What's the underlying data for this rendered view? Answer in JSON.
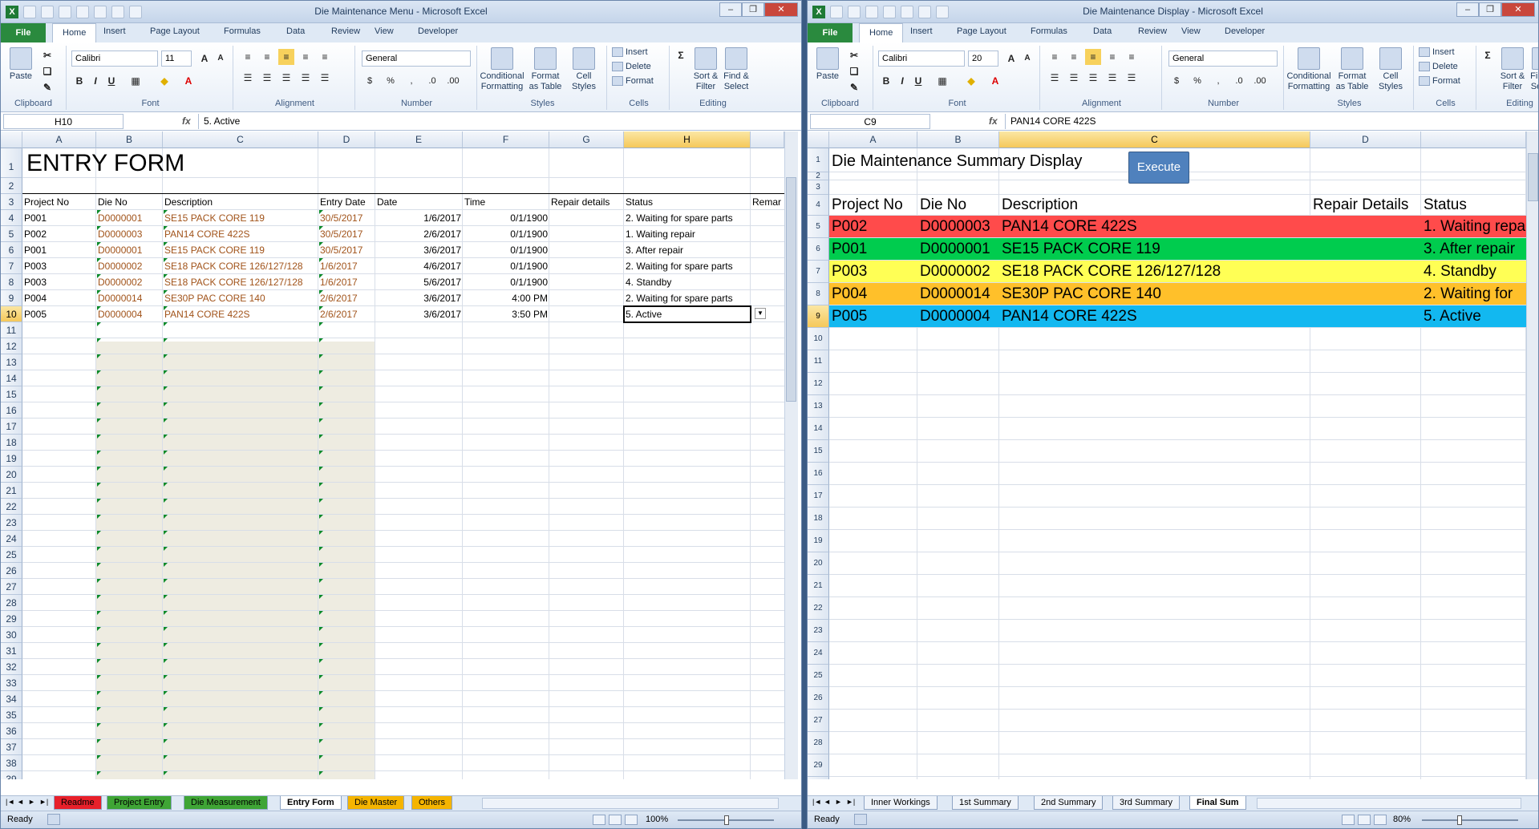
{
  "left": {
    "title": "Die Maintenance Menu - Microsoft Excel",
    "tabs": [
      "File",
      "Home",
      "Insert",
      "Page Layout",
      "Formulas",
      "Data",
      "Review",
      "View",
      "Developer"
    ],
    "ribbon": {
      "clipboard": "Clipboard",
      "paste": "Paste",
      "font_group": "Font",
      "font_name": "Calibri",
      "font_size": "11",
      "alignment": "Alignment",
      "number_group": "Number",
      "number_format": "General",
      "conditional": "Conditional Formatting",
      "format_table": "Format as Table",
      "cell_styles": "Cell Styles",
      "styles": "Styles",
      "insert": "Insert",
      "delete": "Delete",
      "format": "Format",
      "cells": "Cells",
      "sort": "Sort & Filter",
      "find": "Find & Select",
      "editing": "Editing"
    },
    "namebox": "H10",
    "formula": "5. Active",
    "columns": [
      "A",
      "B",
      "C",
      "D",
      "E",
      "F",
      "G",
      "H"
    ],
    "title_cell": "ENTRY FORM",
    "headers": [
      "Project No",
      "Die No",
      "Description",
      "Entry Date",
      "Date",
      "Time",
      "Repair details",
      "Status",
      "Remar"
    ],
    "rows": [
      [
        "P001",
        "D0000001",
        "SE15 PACK CORE 119",
        "30/5/2017",
        "1/6/2017",
        "0/1/1900",
        "",
        "2. Waiting for spare parts"
      ],
      [
        "P002",
        "D0000003",
        "PAN14 CORE 422S",
        "30/5/2017",
        "2/6/2017",
        "0/1/1900",
        "",
        "1. Waiting repair"
      ],
      [
        "P001",
        "D0000001",
        "SE15 PACK CORE 119",
        "30/5/2017",
        "3/6/2017",
        "0/1/1900",
        "",
        "3. After repair"
      ],
      [
        "P003",
        "D0000002",
        "SE18 PACK CORE 126/127/128",
        "1/6/2017",
        "4/6/2017",
        "0/1/1900",
        "",
        "2. Waiting for spare parts"
      ],
      [
        "P003",
        "D0000002",
        "SE18 PACK CORE 126/127/128",
        "1/6/2017",
        "5/6/2017",
        "0/1/1900",
        "",
        "4. Standby"
      ],
      [
        "P004",
        "D0000014",
        "SE30P PAC CORE 140",
        "2/6/2017",
        "3/6/2017",
        "4:00 PM",
        "",
        "2. Waiting for spare parts"
      ],
      [
        "P005",
        "D0000004",
        "PAN14 CORE 422S",
        "2/6/2017",
        "3/6/2017",
        "3:50 PM",
        "",
        "5. Active"
      ]
    ],
    "sheets": [
      "Readme",
      "Project Entry",
      "Die Measurement",
      "Entry Form",
      "Die Master",
      "Others"
    ],
    "sheet_colors": [
      "#e8202a",
      "#3fa535",
      "#3fa535",
      "#ffffff",
      "#f5b400",
      "#f5b400"
    ],
    "status": "Ready",
    "zoom": "100%"
  },
  "right": {
    "title": "Die Maintenance Display - Microsoft Excel",
    "tabs": [
      "File",
      "Home",
      "Insert",
      "Page Layout",
      "Formulas",
      "Data",
      "Review",
      "View",
      "Developer"
    ],
    "ribbon": {
      "clipboard": "Clipboard",
      "paste": "Paste",
      "font_group": "Font",
      "font_name": "Calibri",
      "font_size": "20",
      "alignment": "Alignment",
      "number_group": "Number",
      "number_format": "General",
      "conditional": "Conditional Formatting",
      "format_table": "Format as Table",
      "cell_styles": "Cell Styles",
      "styles": "Styles",
      "insert": "Insert",
      "delete": "Delete",
      "format": "Format",
      "cells": "Cells",
      "sort": "Sort & Filter",
      "find": "Find & Select",
      "editing": "Editing"
    },
    "namebox": "C9",
    "formula": "PAN14 CORE 422S",
    "columns": [
      "A",
      "B",
      "C",
      "D"
    ],
    "summary_title": "Die Maintenance Summary Display",
    "execute": "Execute",
    "headers": [
      "Project No",
      "Die No",
      "Description",
      "Repair Details",
      "Status"
    ],
    "rows": [
      [
        "P002",
        "D0000003",
        "PAN14 CORE 422S",
        "",
        "1. Waiting repa"
      ],
      [
        "P001",
        "D0000001",
        "SE15 PACK CORE 119",
        "",
        "3. After repair"
      ],
      [
        "P003",
        "D0000002",
        "SE18 PACK CORE 126/127/128",
        "",
        "4. Standby"
      ],
      [
        "P004",
        "D0000014",
        "SE30P PAC CORE 140",
        "",
        "2. Waiting for"
      ],
      [
        "P005",
        "D0000004",
        "PAN14 CORE 422S",
        "",
        "5. Active"
      ]
    ],
    "row_colors": [
      "#ff4b4b",
      "#00cc4e",
      "#ffff55",
      "#ffc02a",
      "#12b8f0"
    ],
    "sheets": [
      "Inner Workings",
      "1st Summary",
      "2nd Summary",
      "3rd Summary",
      "Final Sum"
    ],
    "status": "Ready",
    "zoom": "80%"
  }
}
